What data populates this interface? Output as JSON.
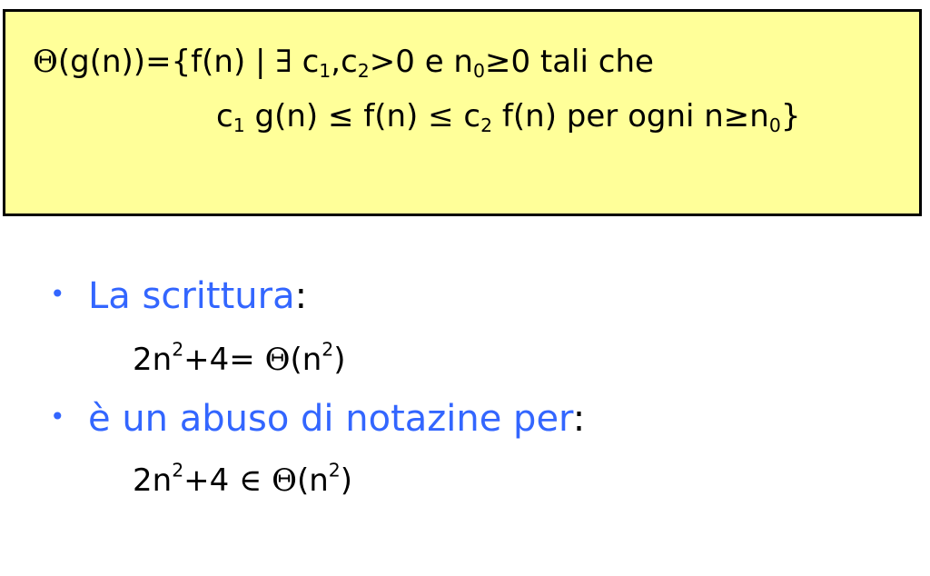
{
  "definition": {
    "line1": {
      "theta": "Θ",
      "a": "(g(n))={f(n) | ",
      "exists": "∃",
      "b": " c",
      "sub1": "1",
      "c": ",c",
      "sub2": "2",
      "d": ">0 e n",
      "sub0": "0",
      "e": "≥0 tali che"
    },
    "line2": {
      "a": "c",
      "sub1": "1",
      "b": " g(n) ≤ f(n) ",
      "leq": "≤",
      "c": " c",
      "sub2": "2",
      "d": " f(n) per ogni n≥n",
      "sub0": "0",
      "e": "}"
    }
  },
  "bullets": [
    {
      "dot": "•",
      "text": "La scrittura",
      "colon": ":"
    },
    {
      "dot": "•",
      "text": "è un abuso di notazine per",
      "colon": ":"
    }
  ],
  "formula1": {
    "a": "2n",
    "sup1": "2",
    "b": "+4= ",
    "theta": "Θ",
    "c": "(n",
    "sup2": "2",
    "d": ")"
  },
  "formula2": {
    "a": "2n",
    "sup1": "2",
    "b": "+4 ",
    "in": "∈",
    "c": " ",
    "theta": "Θ",
    "d": "(n",
    "sup2": "2",
    "e": ")"
  },
  "colors": {
    "box_bg": "#ffff99",
    "bullet_text": "#3366ff"
  }
}
